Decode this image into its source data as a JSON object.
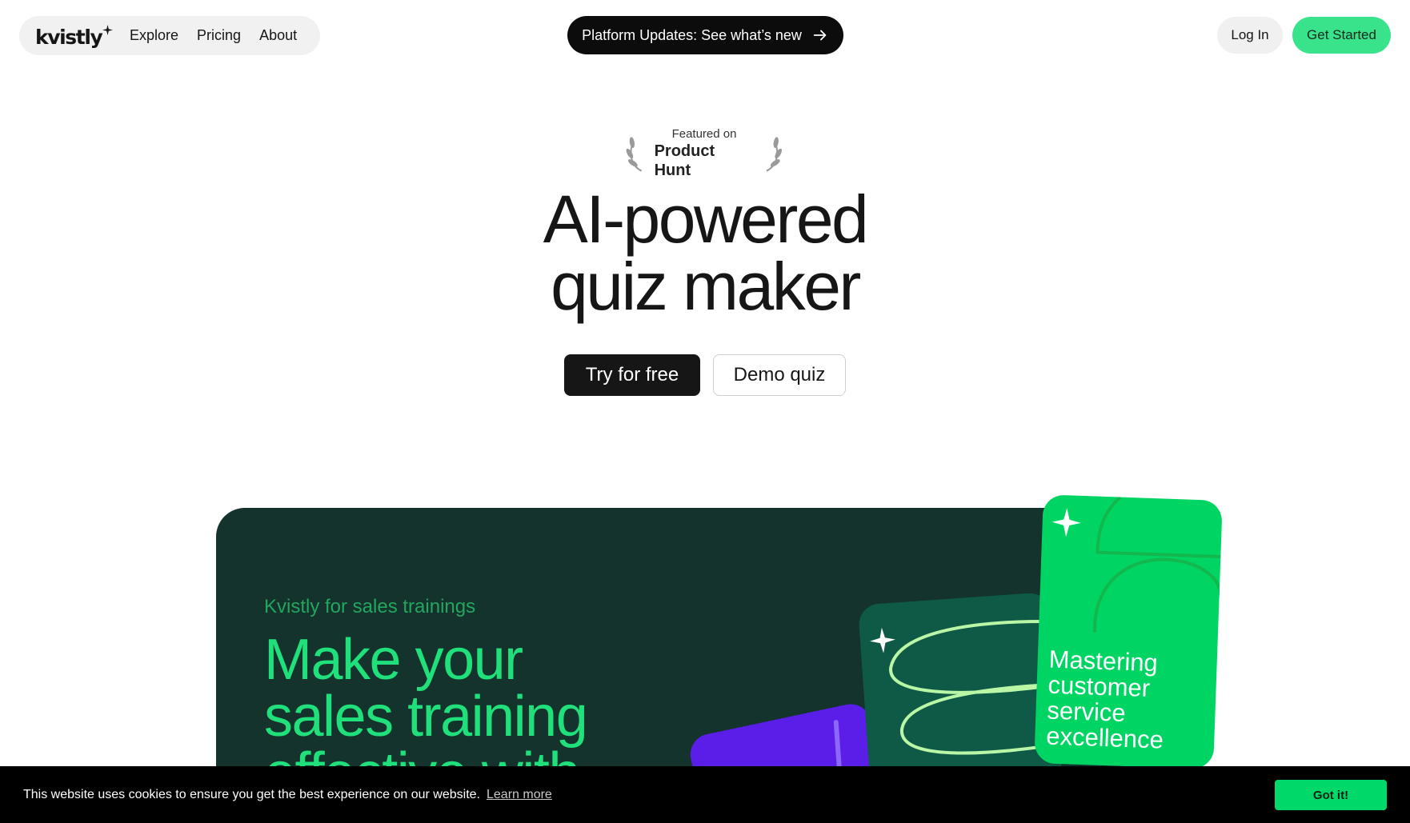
{
  "header": {
    "logo_text": "kvistly",
    "nav": [
      {
        "label": "Explore"
      },
      {
        "label": "Pricing"
      },
      {
        "label": "About"
      }
    ],
    "updates_label": "Platform Updates: See what’s new",
    "login_label": "Log In",
    "get_started_label": "Get Started"
  },
  "hero": {
    "badge_small": "Featured on",
    "badge_big": "Product Hunt",
    "title_line1": "AI-powered",
    "title_line2": "quiz maker",
    "try_label": "Try for free",
    "demo_label": "Demo quiz"
  },
  "feature": {
    "eyebrow": "Kvistly for sales trainings",
    "title": "Make your sales training effective with",
    "card_text": "Mastering customer service excellence"
  },
  "cookie": {
    "message": "This website uses cookies to ensure you get the best experience on our website.",
    "learn_more": "Learn more",
    "accept_label": "Got it!"
  },
  "colors": {
    "brand_green": "#39e38c",
    "dark_green": "#13332c",
    "title_green": "#1fe07a",
    "card_green": "#00d563",
    "purple": "#5a1ee8"
  },
  "icons": [
    "sparkle-icon",
    "arrow-right-icon",
    "laurel-left-icon",
    "laurel-right-icon"
  ]
}
